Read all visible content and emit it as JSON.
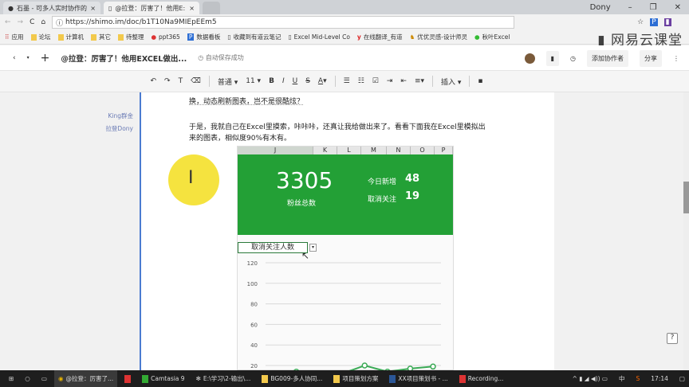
{
  "browser": {
    "tabs": [
      {
        "label": "石墨 - 可多人实时协作的",
        "active": false
      },
      {
        "label": "@拉登：厉害了！他用E:",
        "active": true
      }
    ],
    "user": "Dony",
    "url": "https://shimo.im/doc/b1T10Na9MIEpEEm5",
    "bookmarks": [
      "应用",
      "论坛",
      "计算机",
      "其它",
      "待整理",
      "ppt365",
      "数据看板",
      "收藏到有道云笔记",
      "Excel Mid-Level Co",
      "在线翻译_有道",
      "优优灵感-设计师灵",
      "秋叶Excel"
    ],
    "watermark": "网易云课堂"
  },
  "app": {
    "doc_title": "@拉登：厉害了！他用EXCEL做出...",
    "save_status": "自动保存成功",
    "add_collaborator": "添加协作者",
    "share": "分享"
  },
  "toolbar": {
    "style": "普通",
    "font_size": "11",
    "insert": "插入"
  },
  "doc": {
    "para1": "换，动态刷新图表，岂不是很酷炫？",
    "para2_line1": "于是，我就自己在Excel里摸索，咔咔咔，还真让我给做出来了。看看下面我在Excel里模拟出",
    "para2_line2": "来的图表，相似度90%有木有。",
    "comments": [
      "King群金",
      "拉登Dony"
    ]
  },
  "sheet": {
    "columns": [
      "J",
      "K",
      "L",
      "M",
      "N",
      "O",
      "P"
    ],
    "total": "3305",
    "total_label": "粉丝总数",
    "new_label": "今日新增",
    "new_value": "48",
    "unfollow_label": "取消关注",
    "unfollow_value": "19",
    "dropdown_value": "取消关注人数"
  },
  "chart_data": {
    "type": "line",
    "ylim": [
      0,
      120
    ],
    "yticks": [
      "120",
      "100",
      "80",
      "60",
      "40",
      "20"
    ],
    "grid": true,
    "color": "#3aaa55",
    "values": [
      12,
      14,
      10,
      12,
      20,
      14,
      17,
      19
    ]
  },
  "taskbar": {
    "items": [
      "@拉登：厉害了...",
      "Camtasia 9",
      "E:\\学习\\2-输出\\...",
      "BG009-多人协同...",
      "项目策划方案",
      "XX项目策划书 - ...",
      "Recording..."
    ],
    "ime": "中",
    "time": "17:14"
  }
}
